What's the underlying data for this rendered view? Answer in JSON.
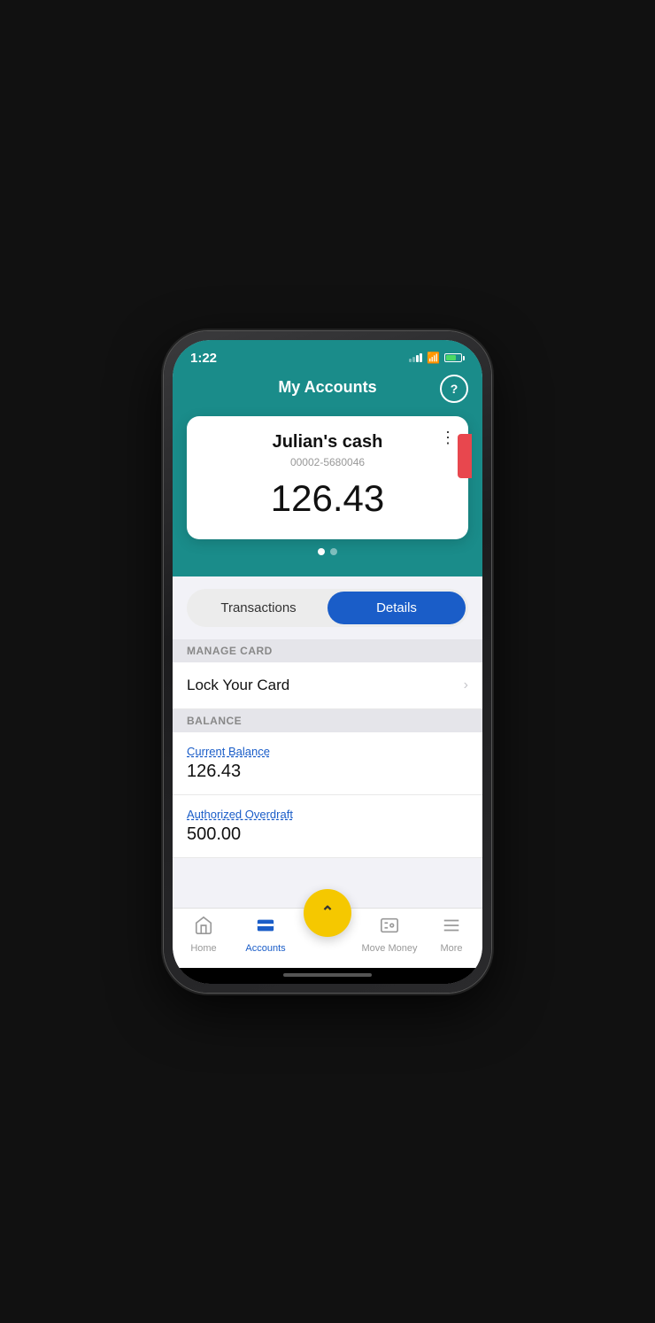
{
  "statusBar": {
    "time": "1:22",
    "signal": "signal-icon",
    "wifi": "wifi-icon",
    "battery": "battery-icon"
  },
  "header": {
    "title": "My Accounts",
    "helpLabel": "?"
  },
  "accountCard": {
    "name": "Julian's cash",
    "number": "00002-5680046",
    "balance": "126.43",
    "menuIcon": "⋮"
  },
  "pagination": {
    "dots": [
      true,
      false
    ]
  },
  "tabs": {
    "transactions": "Transactions",
    "details": "Details"
  },
  "sections": {
    "manageCard": "MANAGE CARD",
    "balance": "BALANCE"
  },
  "manageCardItems": [
    {
      "label": "Lock Your Card"
    }
  ],
  "balanceItems": [
    {
      "label": "Current Balance",
      "value": "126.43"
    },
    {
      "label": "Authorized Overdraft",
      "value": "500.00"
    }
  ],
  "bottomNav": {
    "home": "Home",
    "accounts": "Accounts",
    "moveMoney": "Move Money",
    "more": "More",
    "centerIcon": "∧"
  }
}
